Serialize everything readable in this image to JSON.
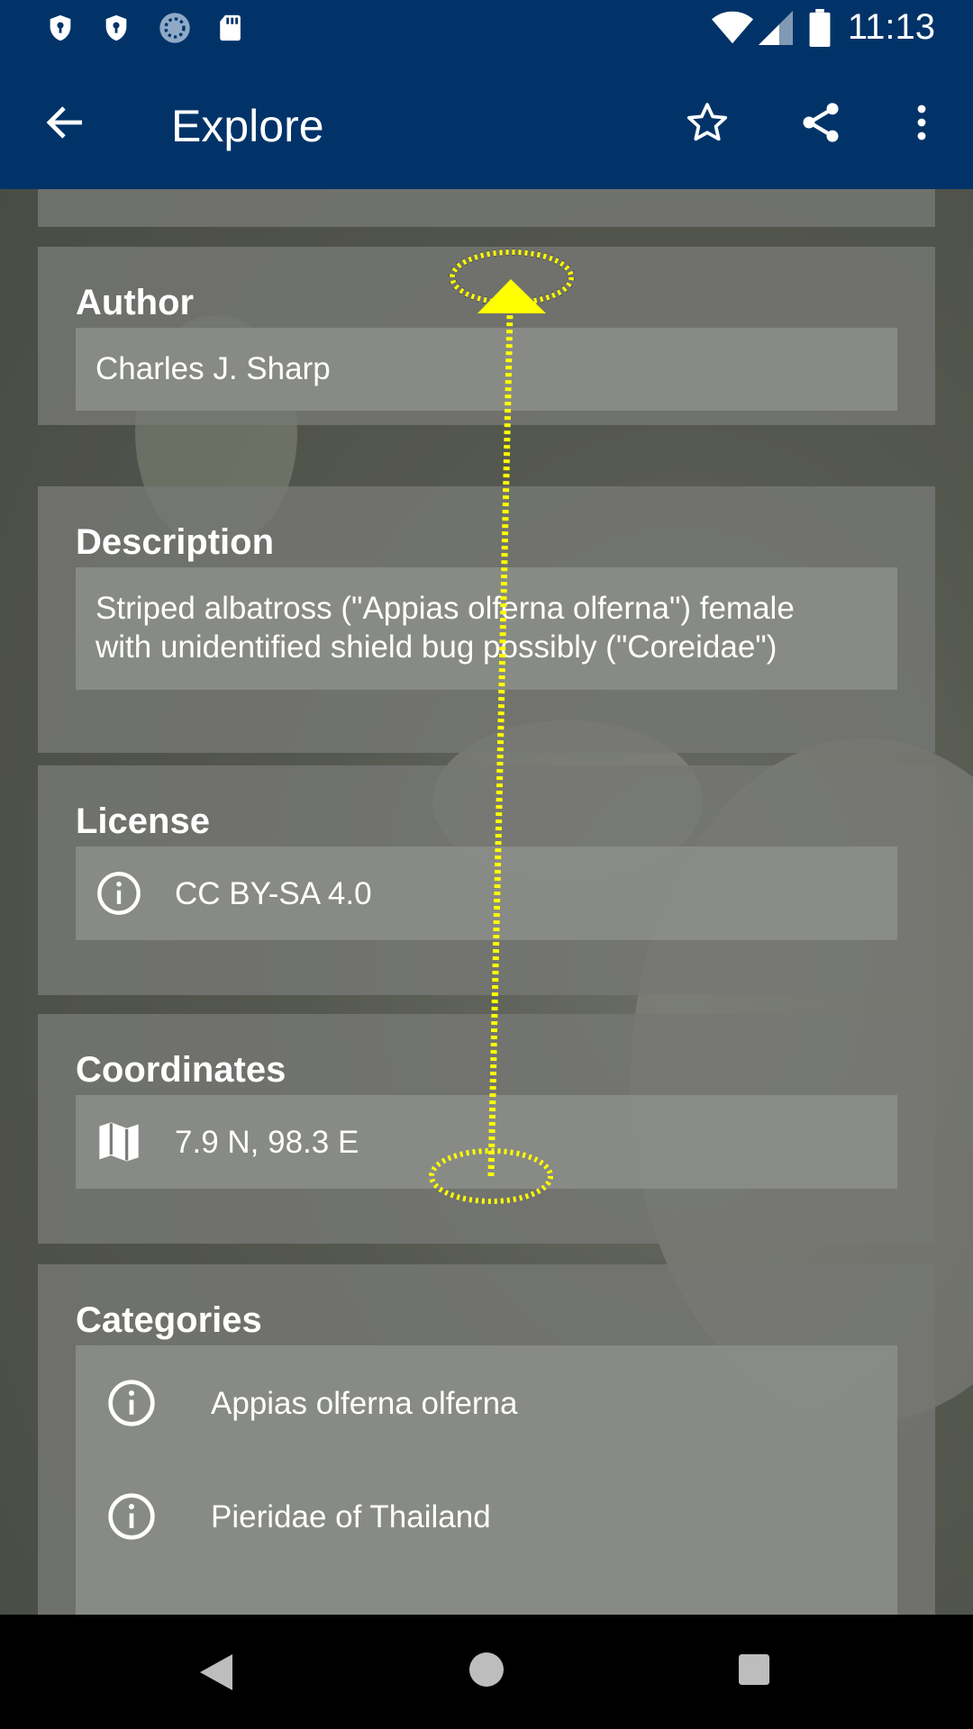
{
  "status_bar": {
    "time": "11:13"
  },
  "app_bar": {
    "title": "Explore",
    "icons": [
      "back-arrow-icon",
      "star-icon",
      "share-icon",
      "more-vert-icon"
    ]
  },
  "sections": {
    "author": {
      "title": "Author",
      "value": "Charles J. Sharp"
    },
    "description": {
      "title": "Description",
      "line1": "Striped albatross (\"Appias olferna olferna\") female",
      "line2": "with unidentified shield bug possibly (\"Coreidae\")"
    },
    "license": {
      "title": "License",
      "value": "CC BY-SA 4.0",
      "icon": "info-icon"
    },
    "coordinates": {
      "title": "Coordinates",
      "value": "7.9 N, 98.3 E",
      "icon": "map-icon"
    },
    "categories": {
      "title": "Categories",
      "items": [
        {
          "label": "Appias olferna olferna",
          "icon": "info-icon"
        },
        {
          "label": "Pieridae of Thailand",
          "icon": "info-icon"
        }
      ]
    }
  },
  "nav_bar": {
    "icons": [
      "back-triangle-icon",
      "home-circle-icon",
      "recents-square-icon"
    ]
  },
  "colors": {
    "app_bar": "#023368",
    "gesture_overlay": "#ffff00"
  }
}
